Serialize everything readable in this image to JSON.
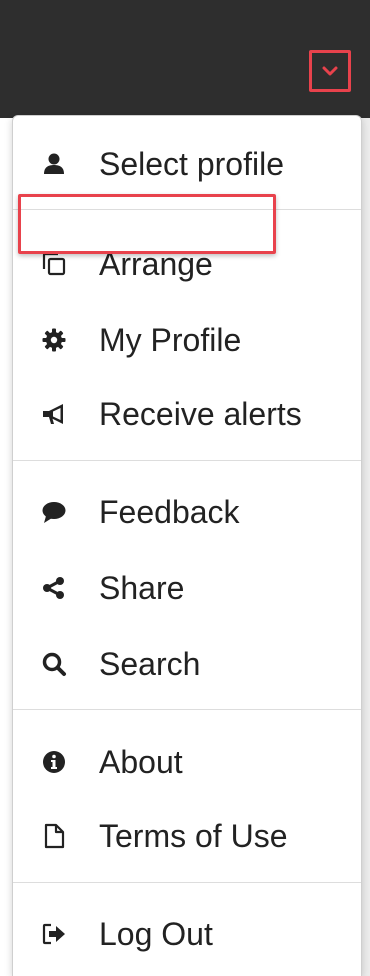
{
  "header": {
    "dropdown_icon": "chevron-down-icon",
    "accent_color": "#e8424c"
  },
  "menu": {
    "items": [
      {
        "label": "Select profile",
        "icon": "user-icon"
      },
      {
        "label": "Arrange",
        "icon": "copy-icon"
      },
      {
        "label": "My Profile",
        "icon": "gear-icon"
      },
      {
        "label": "Receive alerts",
        "icon": "megaphone-icon"
      },
      {
        "label": "Feedback",
        "icon": "comment-icon"
      },
      {
        "label": "Share",
        "icon": "share-icon"
      },
      {
        "label": "Search",
        "icon": "search-icon"
      },
      {
        "label": "About",
        "icon": "info-icon"
      },
      {
        "label": "Terms of Use",
        "icon": "file-icon"
      },
      {
        "label": "Log Out",
        "icon": "sign-out-icon"
      }
    ]
  }
}
